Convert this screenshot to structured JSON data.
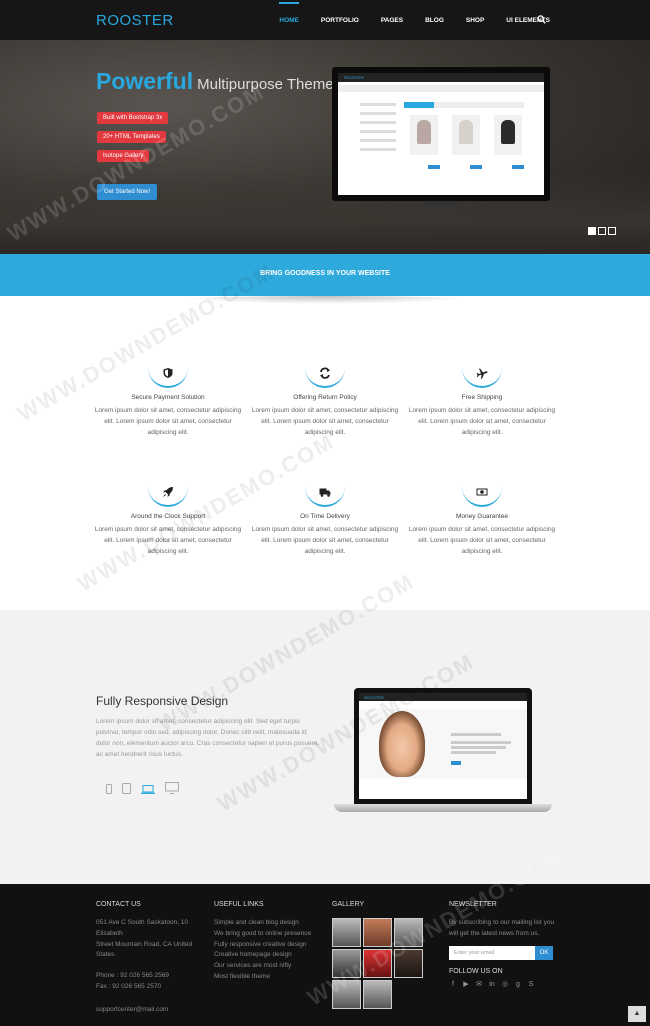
{
  "nav": {
    "logo": "ROOSTER",
    "items": [
      "HOME",
      "PORTFOLIO",
      "PAGES",
      "BLOG",
      "SHOP",
      "UI ELEMENTS"
    ],
    "search_icon": "search-icon"
  },
  "hero": {
    "title_strong": "Powerful",
    "title_rest": "Multipurpose Theme",
    "badges": [
      "Built with Bootstrap 3x",
      "20+ HTML Templates",
      "Isotope Gallery"
    ],
    "cta": "Get Started Now!",
    "monitor_logo": "ROOSTER"
  },
  "band": {
    "text": "BRING GOODNESS IN YOUR WEBSITE"
  },
  "features": [
    {
      "icon": "shield-icon",
      "title": "Secure Payment Solution",
      "desc": "Lorem ipsum dolor sit amet, consectetur adipiscing elit. Lorem ipsum dolor sit amet, consectetur adipiscing elit."
    },
    {
      "icon": "refresh-icon",
      "title": "Offering Return Policy",
      "desc": "Lorem ipsum dolor sit amet, consectetur adipiscing elit. Lorem ipsum dolor sit amet, consectetur adipiscing elit."
    },
    {
      "icon": "plane-icon",
      "title": "Free Shipping",
      "desc": "Lorem ipsum dolor sit amet, consectetur adipiscing elit. Lorem ipsum dolor sit amet, consectetur adipiscing elit."
    },
    {
      "icon": "rocket-icon",
      "title": "Around the Clock Support",
      "desc": "Lorem ipsum dolor sit amet, consectetur adipiscing elit. Lorem ipsum dolor sit amet, consectetur adipiscing elit."
    },
    {
      "icon": "truck-icon",
      "title": "On Time Delivery",
      "desc": "Lorem ipsum dolor sit amet, consectetur adipiscing elit. Lorem ipsum dolor sit amet, consectetur adipiscing elit."
    },
    {
      "icon": "money-icon",
      "title": "Money Guarantee",
      "desc": "Lorem ipsum dolor sit amet, consectetur adipiscing elit. Lorem ipsum dolor sit amet, consectetur adipiscing elit."
    }
  ],
  "responsive": {
    "title": "Fully Responsive Design",
    "text": "Lorem ipsum dolor sit amet, consectetur adipiscing elit. Sed eget turpis pulvinar, tempor odio sed, adipiscing dolor. Donec sitit velit, malesuada id dolor non, elementum auctor arcu. Cras consectetur sapien et purus posuere, ac amet hendrerit risus luctus.",
    "laptop_logo": "ROOSTER",
    "device_icons": [
      "phone-icon",
      "tablet-icon",
      "laptop-icon",
      "desktop-icon"
    ]
  },
  "footer": {
    "contact": {
      "title": "CONTACT US",
      "lines": [
        "051 Ave C South Saskatoon, 10",
        "Elizabeth",
        "Street Mountain Road, CA United",
        "States."
      ],
      "phone": "Phone : 92 026 565 2569",
      "fax": "Fax : 92 026 565 2570",
      "email": "supportcenter@mail.com"
    },
    "links": {
      "title": "USEFUL LINKS",
      "items": [
        "Simple and clean blog design",
        "We bring good to online presence",
        "Fully responsive creative design",
        "Creative homepage design",
        "Our services are most nifty",
        "Most flexible theme"
      ]
    },
    "gallery": {
      "title": "GALLERY"
    },
    "newsletter": {
      "title": "NEWSLETTER",
      "text": "By subscribing to our mailing list you will get the latest news from us.",
      "placeholder": "Enter your email",
      "button": "OK",
      "follow": "FOLLOW US ON"
    }
  },
  "watermark": "WWW.DOWNDEMO.COM"
}
